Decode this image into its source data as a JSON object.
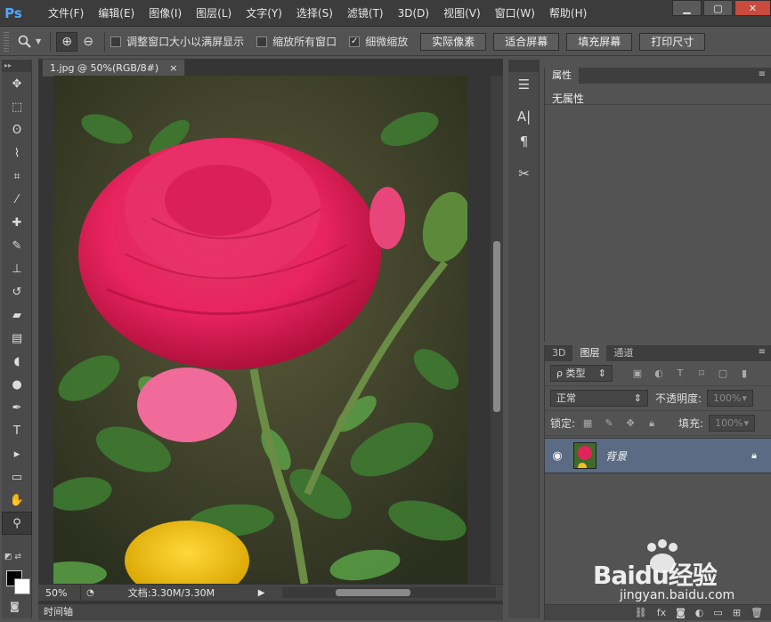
{
  "app": {
    "logo": "Ps",
    "menu": [
      "文件(F)",
      "编辑(E)",
      "图像(I)",
      "图层(L)",
      "文字(Y)",
      "选择(S)",
      "滤镜(T)",
      "3D(D)",
      "视图(V)",
      "窗口(W)",
      "帮助(H)"
    ],
    "window_controls": {
      "minimize": "▁",
      "maximize": "▢",
      "close": "✕"
    }
  },
  "options_bar": {
    "tool_icon": "zoom-tool-icon",
    "zoom_in": "⊕",
    "zoom_out": "⊖",
    "checkboxes": [
      {
        "label": "调整窗口大小以满屏显示",
        "checked": false
      },
      {
        "label": "缩放所有窗口",
        "checked": false
      },
      {
        "label": "细微缩放",
        "checked": true
      }
    ],
    "buttons": [
      "实际像素",
      "适合屏幕",
      "填充屏幕",
      "打印尺寸"
    ]
  },
  "document": {
    "tab_title": "1.jpg @ 50%(RGB/8#)",
    "tab_close": "×",
    "zoom": "50%",
    "doc_info": "文档:3.30M/3.30M"
  },
  "timeline": {
    "label": "时间轴"
  },
  "properties": {
    "tab": "属性",
    "body": "无属性"
  },
  "layers_panel": {
    "tabs": [
      "3D",
      "图层",
      "通道"
    ],
    "active_tab": "图层",
    "filter": "ρ 类型",
    "blend_mode": "正常",
    "opacity_label": "不透明度:",
    "opacity_value": "100%",
    "lock_label": "锁定:",
    "fill_label": "填充:",
    "fill_value": "100%",
    "layers": [
      {
        "name": "背景",
        "visible": true,
        "locked": true
      }
    ],
    "footer_icons": [
      "link-icon",
      "fx-icon",
      "mask-icon",
      "adjustment-icon",
      "group-icon",
      "new-layer-icon",
      "trash-icon"
    ]
  },
  "watermark": {
    "brand": "Baidu经验",
    "url": "jingyan.baidu.com"
  },
  "colors": {
    "accent": "#4ea8ff",
    "layer_selected": "#5b6b84",
    "close_button": "#c94b3d"
  }
}
